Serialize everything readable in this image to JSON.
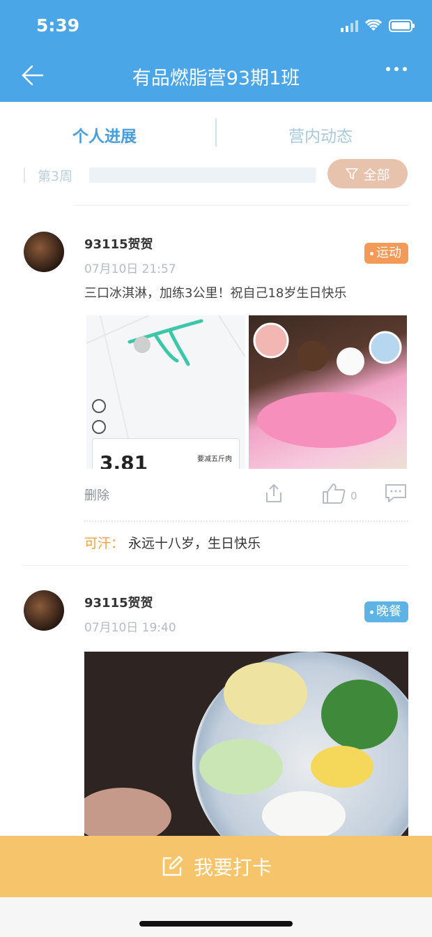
{
  "status_bar": {
    "time": "5:39"
  },
  "nav": {
    "title": "有品燃脂营93期1班"
  },
  "tabs": [
    {
      "label": "个人进展"
    },
    {
      "label": "营内动态"
    }
  ],
  "week": {
    "label": "第3周",
    "filter_label": "全部"
  },
  "posts": [
    {
      "username": "93115贺贺",
      "time": "07月10日  21:57",
      "tag": "运动",
      "tag_color": "#f39a58",
      "text": "三口冰淇淋，加练3公里！祝自己18岁生日快乐",
      "map_distance": "3.81",
      "map_note": "要减五斤肉",
      "delete_label": "删除",
      "like_count": "0",
      "comment": {
        "author": "可汗：",
        "text": " 永远十八岁，生日快乐"
      }
    },
    {
      "username": "93115贺贺",
      "time": "07月10日  19:40",
      "tag": "晚餐",
      "tag_color": "#5db4e4"
    }
  ],
  "checkin": {
    "label": "我要打卡"
  },
  "colors": {
    "primary": "#4aa6e6",
    "checkin": "#f6c46b",
    "filter": "#e7c2ac"
  }
}
